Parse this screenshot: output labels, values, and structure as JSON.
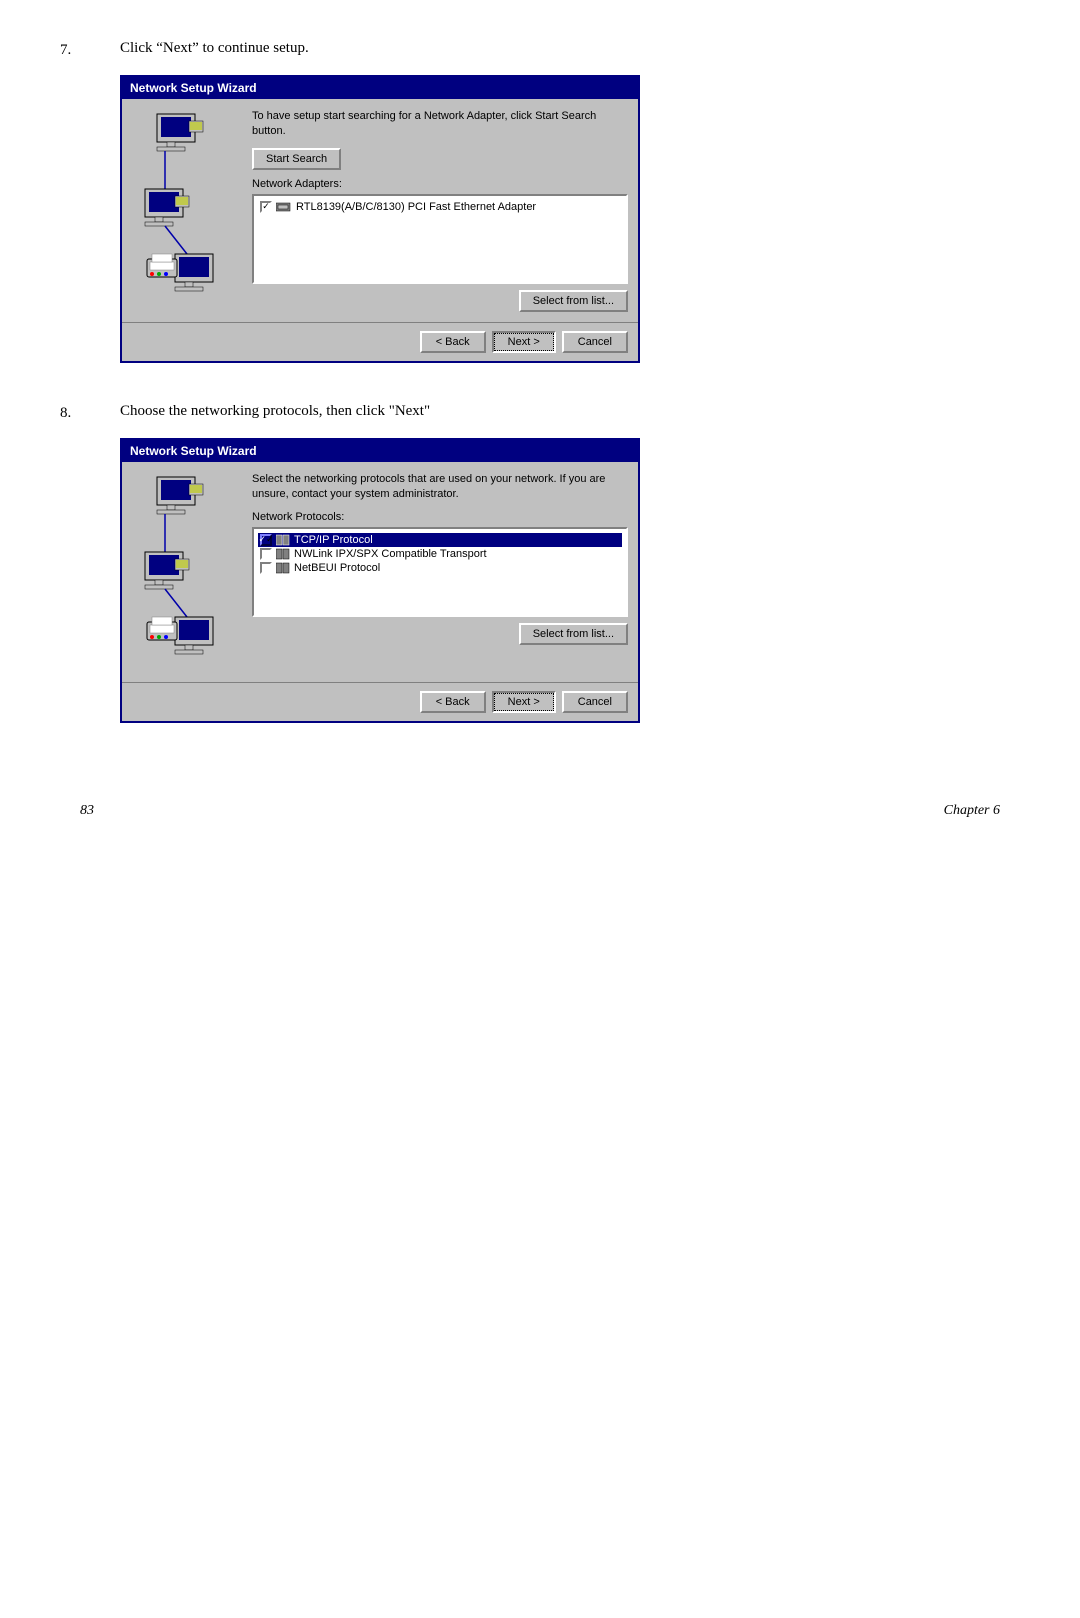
{
  "steps": [
    {
      "number": "7.",
      "text": "Click “Next” to continue setup.",
      "wizard": {
        "title": "Network Setup Wizard",
        "description": "To have setup start searching for a Network Adapter, click Start Search button.",
        "start_search_label": "Start Search",
        "adapters_label": "Network Adapters:",
        "adapter_item": "RTL8139(A/B/C/8130) PCI Fast Ethernet Adapter",
        "select_from_label": "Select from list...",
        "back_label": "< Back",
        "next_label": "Next >",
        "cancel_label": "Cancel"
      }
    },
    {
      "number": "8.",
      "text": "Choose the networking protocols, then click \"Next\"",
      "wizard": {
        "title": "Network Setup Wizard",
        "description": "Select the networking protocols that are used on your network. If you are unsure, contact your system administrator.",
        "protocols_label": "Network Protocols:",
        "protocols": [
          {
            "name": "TCP/IP Protocol",
            "checked": true,
            "highlighted": true
          },
          {
            "name": "NWLink IPX/SPX Compatible Transport",
            "checked": false,
            "highlighted": false
          },
          {
            "name": "NetBEUI Protocol",
            "checked": false,
            "highlighted": false
          }
        ],
        "select_from_label": "Select from list...",
        "back_label": "< Back",
        "next_label": "Next >",
        "cancel_label": "Cancel"
      }
    }
  ],
  "page_footer": {
    "page_number": "83",
    "chapter": "Chapter 6"
  }
}
